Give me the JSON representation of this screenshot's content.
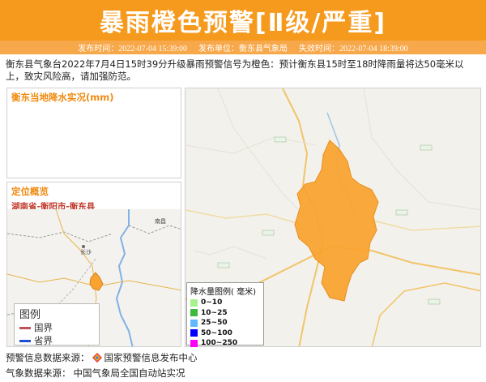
{
  "header": {
    "title": "暴雨橙色预警[Ⅱ级/严重]",
    "publish_time": "发布时间：2022-07-04 15:39:00",
    "publisher": "发布单位：衡东县气象局",
    "expire_time": "失效时间：2022-07-04 18:39:00",
    "accent_color": "#f59a1c"
  },
  "description": "衡东县气象台2022年7月4日15时39分升级暴雨预警信号为橙色：预计衡东县15时至18时降雨量将达50毫米以上，致灾风险高，请加强防范。",
  "rain_panel": {
    "title": "衡东当地降水实况(mm)"
  },
  "location_panel": {
    "title": "定位概览",
    "region": "湖南省-衡阳市-衡东县",
    "map_labels": [
      "长沙",
      "南昌"
    ],
    "legend": {
      "title": "图例",
      "items": [
        {
          "label": "国界",
          "color": "#c0505a"
        },
        {
          "label": "省界",
          "color": "#1f4fd1"
        }
      ]
    }
  },
  "main_map": {
    "region_color": "#f9a331",
    "legend": {
      "title": "降水量图例( 毫米)",
      "items": [
        {
          "label": "0~10",
          "color": "#a6f28f"
        },
        {
          "label": "10~25",
          "color": "#3dba3d"
        },
        {
          "label": "25~50",
          "color": "#61b8ff"
        },
        {
          "label": "50~100",
          "color": "#0000ff"
        },
        {
          "label": "100~250",
          "color": "#fa00fa"
        }
      ]
    }
  },
  "sources": {
    "warning_label": "预警信息数据来源：",
    "warning_source": "国家预警信息发布中心",
    "weather_label": "气象数据来源：",
    "weather_source": "中国气象局全国自动站实况"
  }
}
